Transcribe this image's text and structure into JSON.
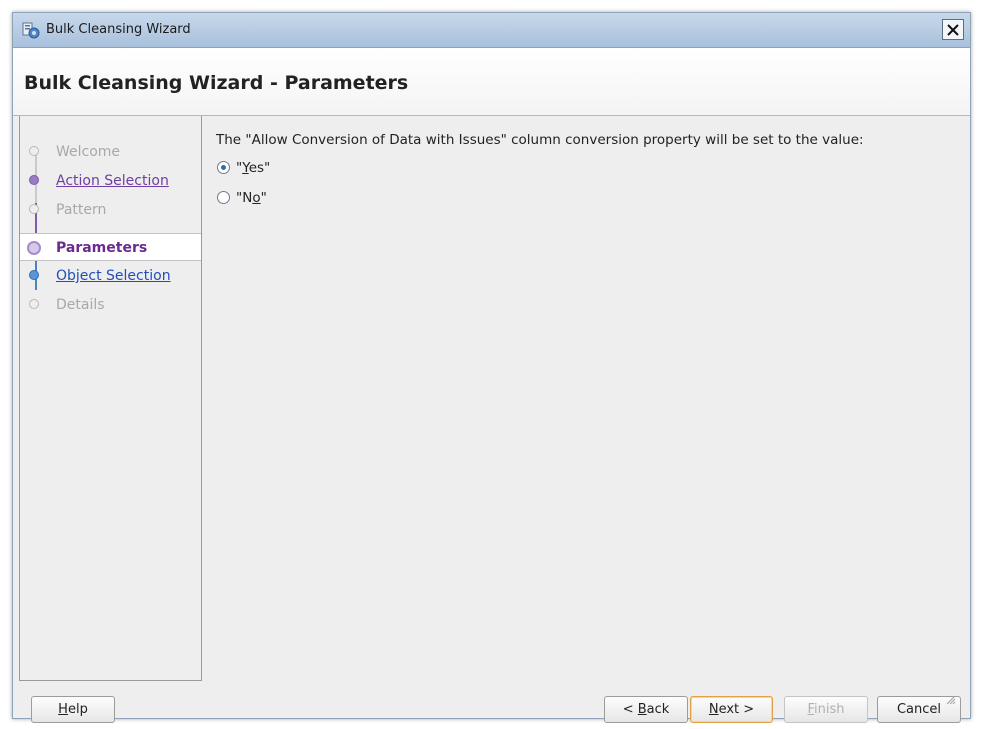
{
  "window": {
    "title": "Bulk Cleansing Wizard",
    "icon": "wizard-app-icon"
  },
  "header": {
    "title": "Bulk Cleansing Wizard - Parameters"
  },
  "steps": [
    {
      "label": "Welcome",
      "state": "disabled"
    },
    {
      "label": "Action Selection",
      "state": "visited"
    },
    {
      "label": "Pattern",
      "state": "disabled"
    },
    {
      "label": "Parameters",
      "state": "current"
    },
    {
      "label": "Object Selection",
      "state": "enabled"
    },
    {
      "label": "Details",
      "state": "disabled"
    }
  ],
  "main": {
    "instruction": "The \"Allow Conversion of Data with Issues\" column conversion property will be set to the value:",
    "options": [
      {
        "pre": "\"",
        "mnemonic": "Y",
        "post": "es\"",
        "selected": true
      },
      {
        "pre": "\"N",
        "mnemonic": "o",
        "post": "\"",
        "selected": false
      }
    ]
  },
  "buttons": {
    "help": {
      "mnemonic": "H",
      "rest": "elp"
    },
    "back": {
      "pre": "< ",
      "mnemonic": "B",
      "rest": "ack"
    },
    "next": {
      "mnemonic": "N",
      "rest": "ext >"
    },
    "finish": {
      "mnemonic": "F",
      "rest": "inish",
      "enabled": false
    },
    "cancel": "Cancel"
  },
  "colors": {
    "visited_link": "#6e3fa3",
    "link": "#1f4fb8",
    "current_step": "#6b2a8f",
    "disabled_text": "#a8a8a8"
  }
}
